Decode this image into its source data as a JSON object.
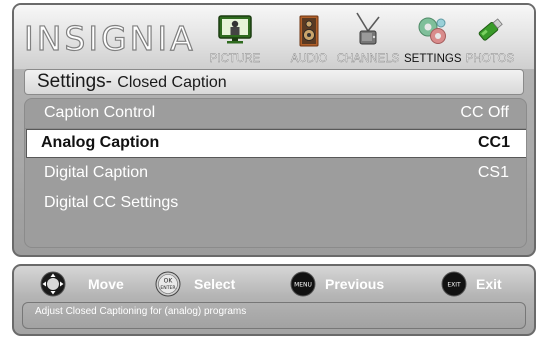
{
  "brand": {
    "logo_text": "INSIGNIA"
  },
  "menu": {
    "tabs": [
      {
        "label": "PICTURE",
        "icon": "tv-icon",
        "active": false
      },
      {
        "label": "AUDIO",
        "icon": "speaker-icon",
        "active": false
      },
      {
        "label": "CHANNELS",
        "icon": "antenna-icon",
        "active": false
      },
      {
        "label": "SETTINGS",
        "icon": "gears-icon",
        "active": true
      },
      {
        "label": "PHOTOS",
        "icon": "usb-drive-icon",
        "active": false
      }
    ]
  },
  "page": {
    "title": "Settings-",
    "subtitle": "Closed Caption"
  },
  "settings": {
    "items": [
      {
        "label": "Caption Control",
        "value": "CC Off",
        "selected": false
      },
      {
        "label": "Analog Caption",
        "value": "CC1",
        "selected": true
      },
      {
        "label": "Digital Caption",
        "value": "CS1",
        "selected": false
      },
      {
        "label": "Digital CC Settings",
        "value": "",
        "selected": false
      }
    ]
  },
  "help": {
    "nav": [
      {
        "label": "Move",
        "icon": "dpad-icon"
      },
      {
        "label": "Select",
        "icon": "ok-enter-icon",
        "icon_text_top": "OK",
        "icon_text_bottom": "ENTER"
      },
      {
        "label": "Previous",
        "icon": "menu-button-icon",
        "icon_text": "MENU"
      },
      {
        "label": "Exit",
        "icon": "exit-button-icon",
        "icon_text": "EXIT"
      }
    ],
    "status": "Adjust Closed Captioning for (analog) programs"
  },
  "colors": {
    "panel_gray": "#a9a9a9",
    "selected_row": "#ffffff",
    "text_light": "#ffffff",
    "text_dark": "#111111"
  }
}
